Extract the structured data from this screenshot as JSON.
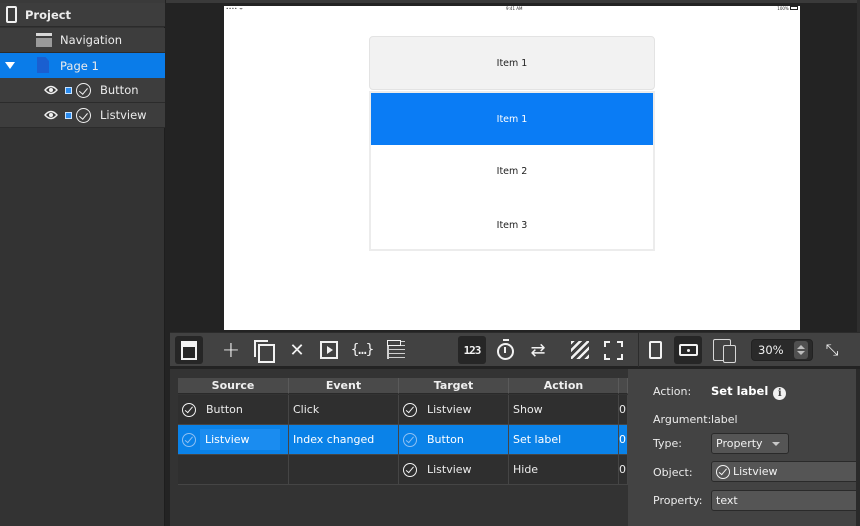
{
  "tree": {
    "project": {
      "label": "Project",
      "icon": "phone-icon"
    },
    "navigation": {
      "label": "Navigation",
      "icon": "navigation-icon"
    },
    "page": {
      "label": "Page 1",
      "icon": "page-icon",
      "expanded": true,
      "selected": true
    },
    "children": [
      {
        "label": "Button",
        "visible": true,
        "checked": true
      },
      {
        "label": "Listview",
        "visible": true,
        "checked": true
      }
    ]
  },
  "device": {
    "statusbar": {
      "left": "•••• ᯤ",
      "center": "9:41 AM",
      "right": "100%"
    },
    "button_label": "Item 1",
    "list_items": [
      {
        "label": "Item 1",
        "selected": true
      },
      {
        "label": "Item 2",
        "selected": false
      },
      {
        "label": "Item 3",
        "selected": false
      }
    ],
    "accent": "#0a7cf5"
  },
  "toolbar": {
    "buttons": [
      {
        "name": "form-view",
        "icon": "form-icon",
        "active": true
      },
      {
        "name": "add",
        "icon": "plus-icon",
        "glyph": "+"
      },
      {
        "name": "duplicate",
        "icon": "copy-icon"
      },
      {
        "name": "delete",
        "icon": "close-icon",
        "glyph": "✕"
      },
      {
        "name": "run",
        "icon": "play-icon"
      },
      {
        "name": "script",
        "icon": "braces-icon",
        "glyph": "{…}"
      },
      {
        "name": "table",
        "icon": "table-icon"
      },
      {
        "name": "numbers",
        "icon": "numeric-icon",
        "glyph": "123",
        "active": true
      },
      {
        "name": "timer",
        "icon": "timer-icon"
      },
      {
        "name": "loop",
        "icon": "repeat-icon",
        "glyph": "⇄"
      },
      {
        "name": "pattern",
        "icon": "hatch-icon"
      },
      {
        "name": "selection",
        "icon": "dashed-rect-icon"
      },
      {
        "name": "portrait",
        "icon": "portrait-icon"
      },
      {
        "name": "landscape",
        "icon": "landscape-icon",
        "active": true
      },
      {
        "name": "devices",
        "icon": "devices-icon"
      },
      {
        "name": "collapse",
        "icon": "collapse-icon",
        "glyph": "⤡"
      }
    ],
    "zoom_value": "30%"
  },
  "events_table": {
    "columns": [
      "Source",
      "Event",
      "Target",
      "Action"
    ],
    "rows": [
      {
        "source": "Button",
        "event": "Click",
        "target": "Listview",
        "action": "Show",
        "extra": "0",
        "selected": false
      },
      {
        "source": "Listview",
        "event": "Index changed",
        "target": "Button",
        "action": "Set label",
        "extra": "0",
        "selected": true
      },
      {
        "source": "",
        "event": "",
        "target": "Listview",
        "action": "Hide",
        "extra": "0",
        "selected": false
      }
    ]
  },
  "properties": {
    "action_label": "Action:",
    "action_value": "Set label",
    "info_glyph": "i",
    "argument_label": "Argument:",
    "argument_value": "label",
    "type_label": "Type:",
    "type_value": "Property",
    "object_label": "Object:",
    "object_value": "Listview",
    "property_label": "Property:",
    "property_value": "text"
  }
}
